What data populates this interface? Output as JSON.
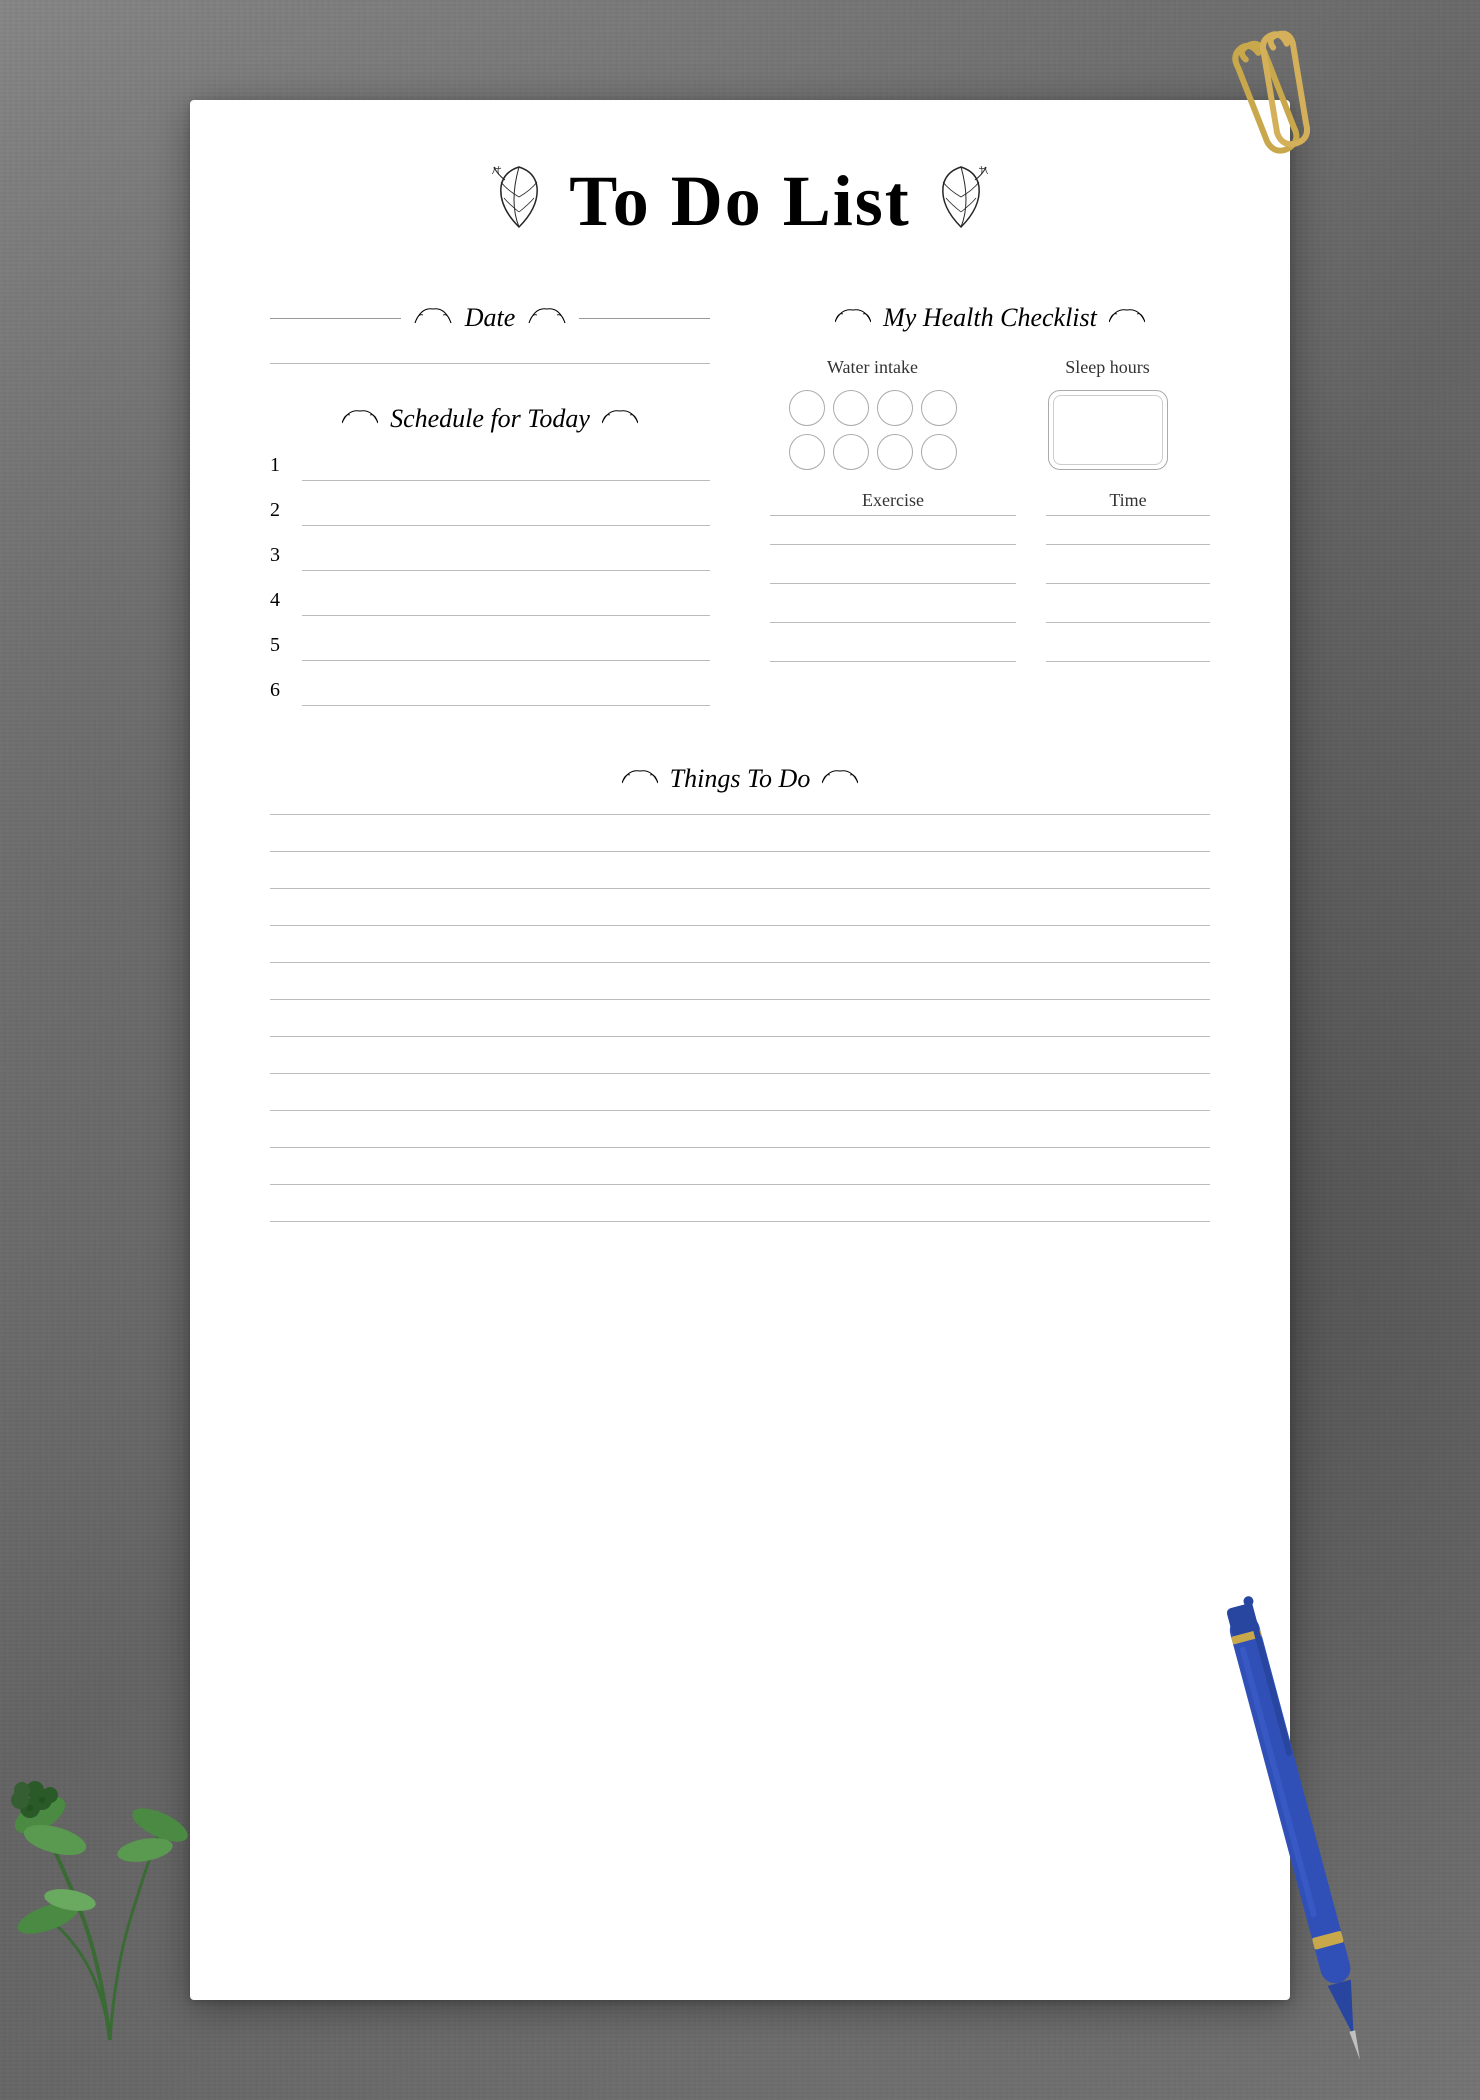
{
  "page": {
    "title": "To Do List",
    "background": "#7a7a7a"
  },
  "date_section": {
    "label": "Date"
  },
  "schedule_section": {
    "label": "Schedule for Today",
    "items": [
      {
        "number": "1"
      },
      {
        "number": "2"
      },
      {
        "number": "3"
      },
      {
        "number": "4"
      },
      {
        "number": "5"
      },
      {
        "number": "6"
      }
    ]
  },
  "health_section": {
    "label": "My Health Checklist",
    "water_label": "Water intake",
    "sleep_label": "Sleep hours",
    "exercise_label": "Exercise",
    "time_label": "Time",
    "water_circles": 8,
    "exercise_rows": 4
  },
  "things_section": {
    "label": "Things To Do",
    "lines": 12
  }
}
